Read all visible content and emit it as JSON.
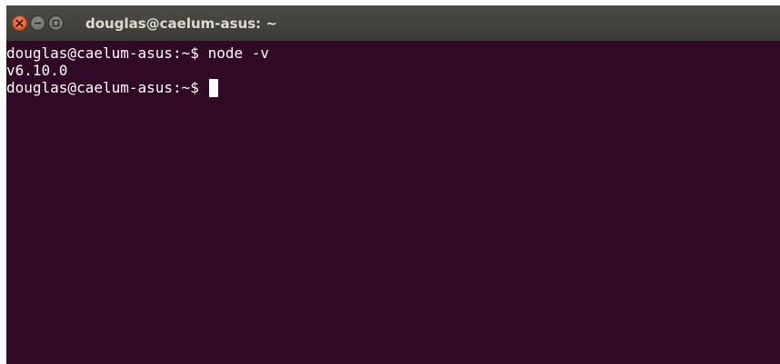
{
  "window": {
    "title": "douglas@caelum-asus: ~",
    "buttons": {
      "close_icon": "close-icon",
      "minimize_icon": "minimize-icon",
      "maximize_icon": "maximize-icon"
    }
  },
  "terminal": {
    "lines": [
      {
        "prompt": "douglas@caelum-asus:~$ ",
        "command": "node -v"
      },
      {
        "output": "v6.10.0"
      },
      {
        "prompt": "douglas@caelum-asus:~$ ",
        "command": ""
      }
    ],
    "colors": {
      "background": "#300a24",
      "text": "#ffffff",
      "titlebar": "#3c3b37",
      "close_button": "#df4b16"
    }
  }
}
